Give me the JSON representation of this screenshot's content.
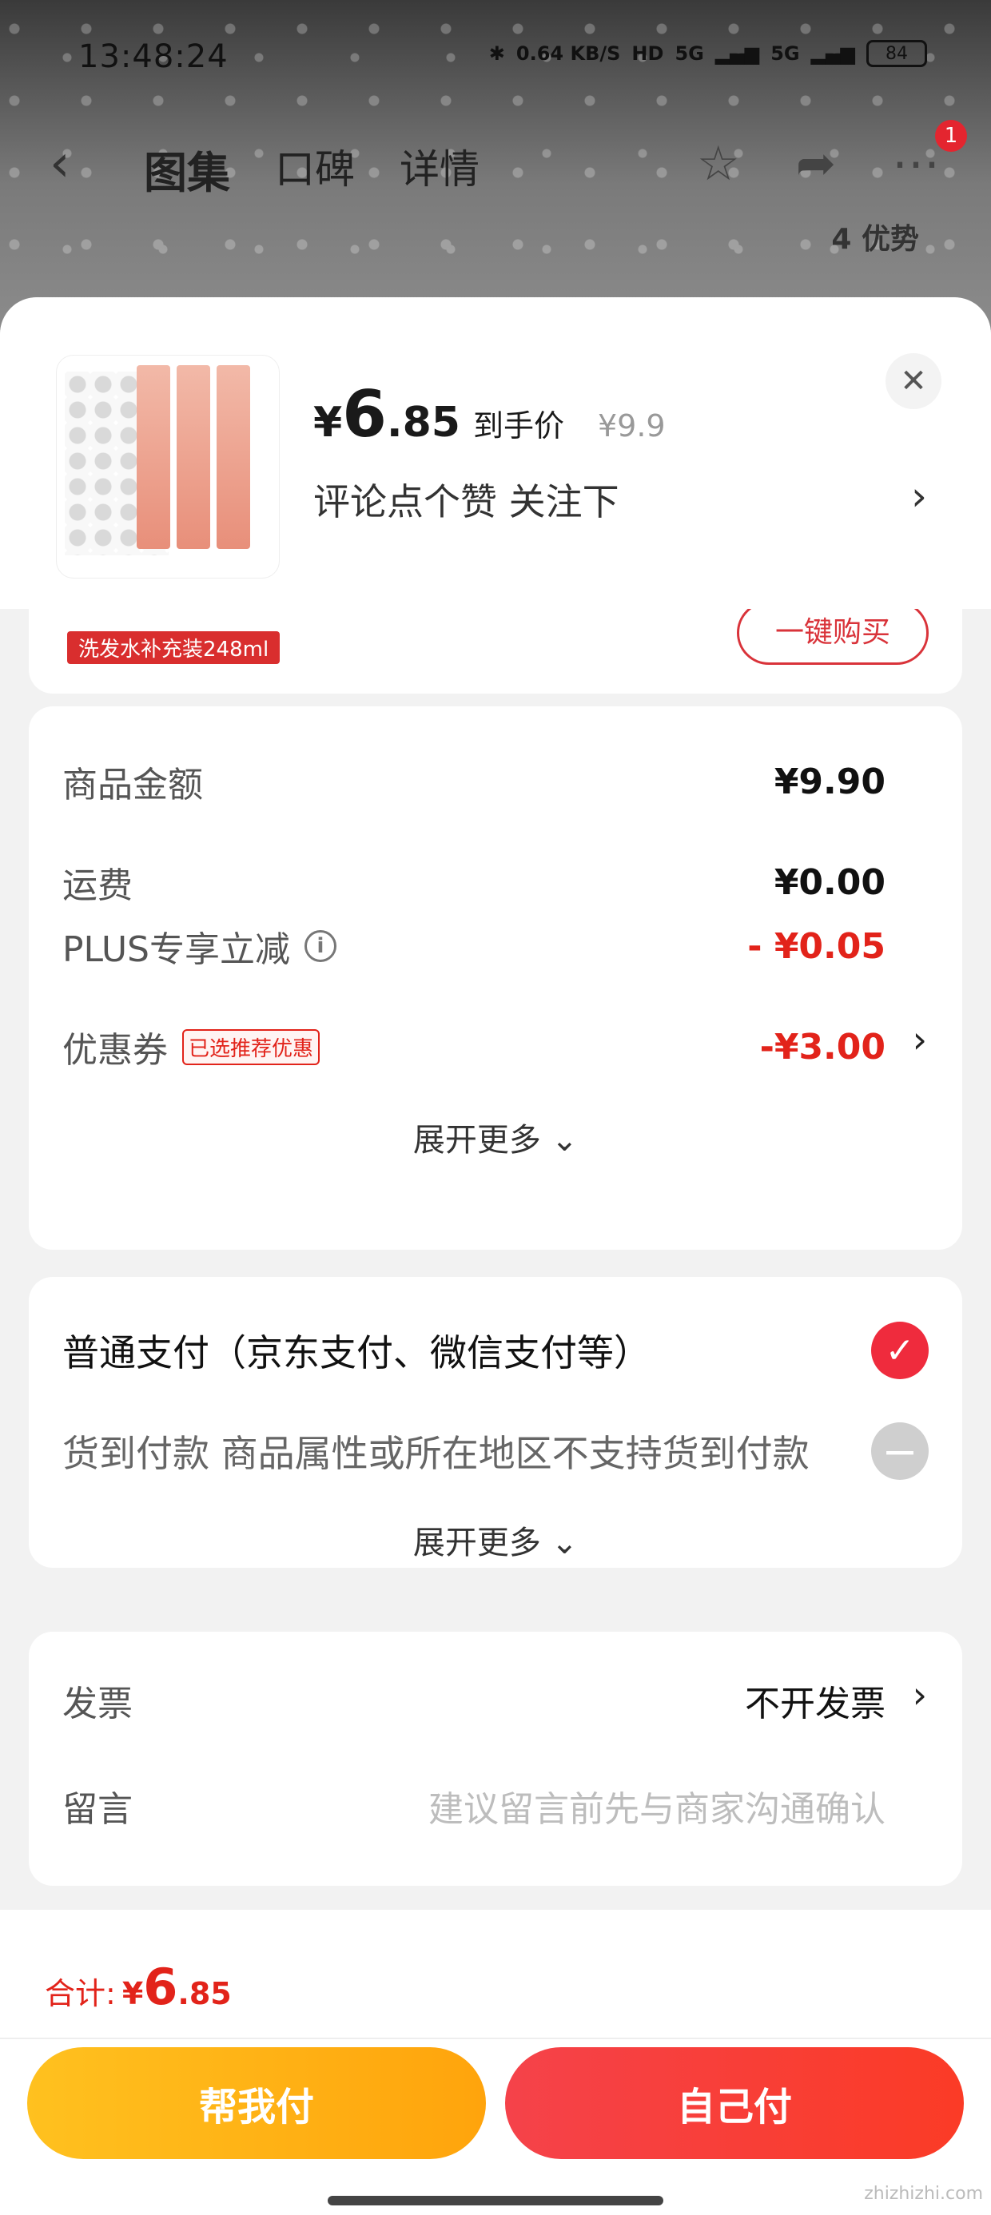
{
  "status_bar": {
    "time": "13:48:24",
    "net_speed": "0.64 KB/S",
    "hd": "HD",
    "sig1": "5G",
    "sig2": "5G",
    "battery": "84"
  },
  "nav": {
    "tabs": [
      "图集",
      "口碑",
      "详情"
    ],
    "cart_badge": "1",
    "advantage": "4 优势"
  },
  "sheet_head": {
    "price_yen": "¥",
    "price_int": "6",
    "price_dec": ".85",
    "price_label": "到手价",
    "orig_price": "¥9.9",
    "promo_text": "评论点个赞  关注下"
  },
  "partial_card": {
    "tag": "洗发水补充装248ml",
    "button": "一键购买"
  },
  "price_detail": {
    "rows": [
      {
        "label": "商品金额",
        "value": "¥9.90"
      },
      {
        "label": "运费",
        "value": "¥0.00"
      },
      {
        "label": "PLUS专享立减",
        "value": "- ¥0.05"
      },
      {
        "label": "优惠券",
        "tag": "已选推荐优惠",
        "value": "-¥3.00"
      }
    ],
    "expand": "展开更多"
  },
  "payment": {
    "normal": "普通支付（京东支付、微信支付等）",
    "cod": "货到付款 商品属性或所在地区不支持货到付款",
    "expand": "展开更多"
  },
  "extra": {
    "invoice_label": "发票",
    "invoice_value": "不开发票",
    "message_label": "留言",
    "message_placeholder": "建议留言前先与商家沟通确认"
  },
  "bottom": {
    "total_label": "合计:",
    "total_yen": "¥",
    "total_int": "6",
    "total_dec": ".85",
    "friend_pay": "帮我付",
    "self_pay": "自己付"
  },
  "watermark": "zhizhizhi.com",
  "colors": {
    "accent_red": "#e2231a",
    "friend_btn": "#ffb416",
    "self_btn": "#f5424a"
  }
}
